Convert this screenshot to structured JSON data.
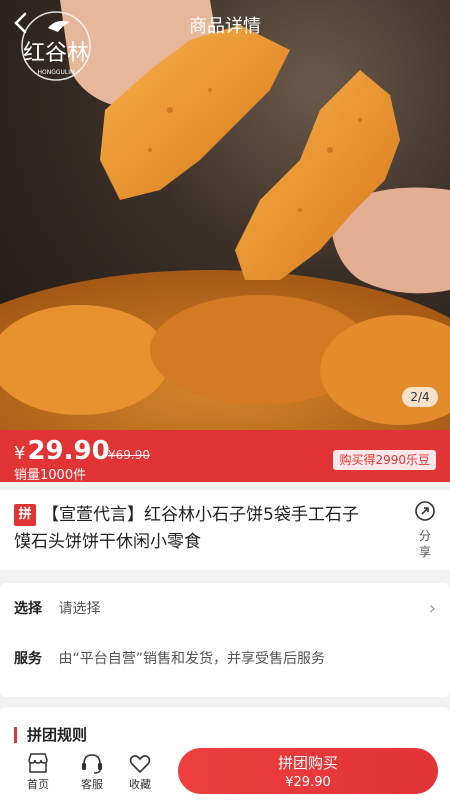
{
  "header": {
    "title": "商品详情",
    "back_icon": "chevron-left-icon"
  },
  "logo": {
    "text": "红谷林",
    "sub": "HONGGULIN"
  },
  "gallery": {
    "current": "2",
    "total": "4",
    "pager_text": "2/4"
  },
  "price": {
    "currency": "¥",
    "current": "29.90",
    "original": "¥69.90",
    "sales": "销量1000件",
    "bonus": "购买得2990乐豆"
  },
  "product": {
    "tag": "拼",
    "title": "【宣萱代言】红谷林小石子饼5袋手工石子馍石头饼饼干休闲小零食",
    "share_label": "分享"
  },
  "options": {
    "select_key": "选择",
    "select_value": "请选择",
    "service_key": "服务",
    "service_value": "由“平台自营”销售和发货，并享受售后服务"
  },
  "group": {
    "rules_title": "拼团规则"
  },
  "bottom": {
    "home": "首页",
    "service": "客服",
    "favorite": "收藏",
    "buy_label": "拼团购买",
    "buy_price": "¥29.90"
  },
  "colors": {
    "accent": "#e23335"
  }
}
